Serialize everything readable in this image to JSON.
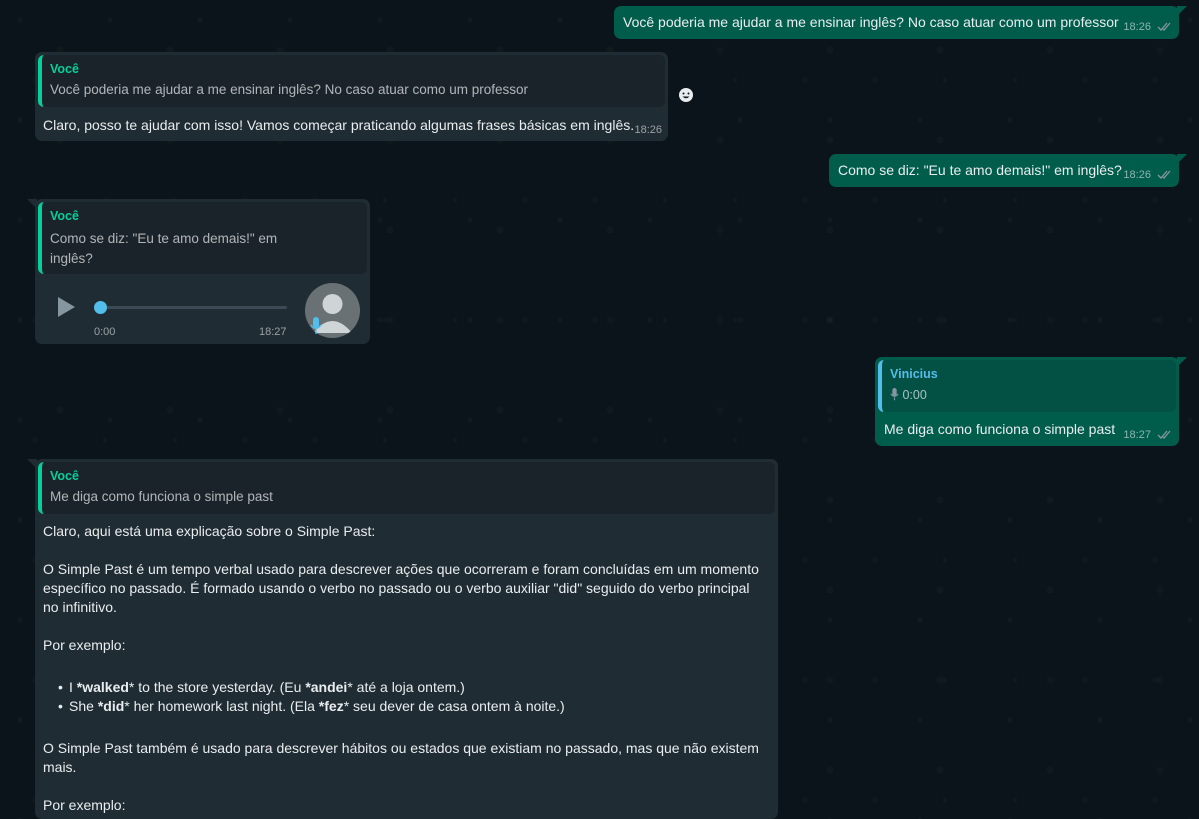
{
  "msg1": {
    "text": "Você poderia me ajudar a me ensinar inglês? No caso atuar como um professor",
    "time": "18:26"
  },
  "msg2": {
    "quote_author": "Você",
    "quote_text": "Você poderia me ajudar a me ensinar inglês? No caso atuar como um professor",
    "text": "Claro, posso te ajudar com isso! Vamos começar praticando algumas frases básicas em inglês.",
    "time": "18:26"
  },
  "msg3": {
    "text": "Como se diz: \"Eu te amo demais!\" em inglês?",
    "time": "18:26"
  },
  "msg4": {
    "quote_author": "Você",
    "quote_text": "Como se diz: \"Eu te amo demais!\" em inglês?",
    "audio_duration": "0:00",
    "time": "18:27",
    "progress": 0
  },
  "msg5": {
    "quote_author": "Vinicius",
    "quote_audio": "0:00",
    "text": "Me diga como funciona o simple past",
    "time": "18:27"
  },
  "msg6": {
    "quote_author": "Você",
    "quote_text": "Me diga como funciona o simple past",
    "p1": "Claro, aqui está uma explicação sobre o Simple Past:",
    "p2": "O Simple Past é um tempo verbal usado para descrever ações que ocorreram e foram concluídas em um momento específico no passado. É formado usando o verbo no passado ou o verbo auxiliar \"did\" seguido do verbo principal no infinitivo.",
    "p3": "Por exemplo:",
    "b1": {
      "a": "I ",
      "b": "*walked",
      "c": "* to the store yesterday. (Eu ",
      "d": "*andei",
      "e": "* até a loja ontem.)"
    },
    "b2": {
      "a": "She ",
      "b": "*did",
      "c": "* her homework last night. (Ela ",
      "d": "*fez",
      "e": "* seu dever de casa ontem à noite.)"
    },
    "p4": "O Simple Past também é usado para descrever hábitos ou estados que existiam no passado, mas que não existem mais.",
    "p5": "Por exemplo:"
  }
}
